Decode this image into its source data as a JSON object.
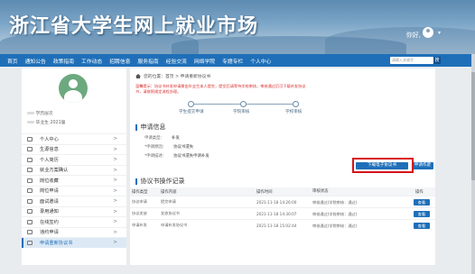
{
  "header": {
    "site_title": "浙江省大学生网上就业市场",
    "user_greeting": "你好, ",
    "user_caret": "▾"
  },
  "nav": {
    "items": [
      "首页",
      "通知公告",
      "政策指南",
      "工作动态",
      "招聘信息",
      "服务指南",
      "经验交流",
      "网络学院",
      "专题专栏",
      "个人中心"
    ],
    "search_placeholder": "请输入关键字",
    "search_button": "搜"
  },
  "sidebar": {
    "info_line_1": "学历层次",
    "info_line_2": "毕业生 2021届",
    "menu": [
      {
        "label": "个人中心",
        "active": false
      },
      {
        "label": "生源信息",
        "active": false
      },
      {
        "label": "个人简历",
        "active": false
      },
      {
        "label": "就业方案确认",
        "active": false
      },
      {
        "label": "岗位收藏",
        "active": false
      },
      {
        "label": "岗位申请",
        "active": false
      },
      {
        "label": "面试邀请",
        "active": false
      },
      {
        "label": "录用通知",
        "active": false
      },
      {
        "label": "在线签约",
        "active": false
      },
      {
        "label": "违约申请",
        "active": false
      },
      {
        "label": "申请重新协议书",
        "active": true
      }
    ]
  },
  "main": {
    "breadcrumb": "您的位置：首页 > 申请重新协议书",
    "notice": "温馨提示：协议书补发申请需由毕业生本人提交，提交后请等待学校审核，审核通过后可下载补发协议书，请按照规定流程办理。",
    "steps": [
      "学生提交申请",
      "学院审核",
      "学校审核"
    ],
    "apply_info_title": "申请信息",
    "apply_fields": [
      {
        "key": "申请类型：",
        "value": "补发"
      },
      {
        "key": "*申请原因：",
        "value": "协议书遗失"
      },
      {
        "key": "*申请描述：",
        "value": "协议书遗失申请补发"
      }
    ],
    "download_button": "下载电子协议书",
    "apply_button": "申请作废",
    "record_title": "协议书操作记录",
    "table": {
      "headers": [
        "操作类型",
        "操作内容",
        "操作时间",
        "审核状态",
        "操作"
      ],
      "rows": [
        {
          "type": "协议申请",
          "content": "提交申请",
          "time": "2021-11-18 14:26:00",
          "status": "审核通过(学院审核：通过)",
          "action": "查看"
        },
        {
          "type": "协议发放",
          "content": "发放协议书",
          "time": "2021-11-18 14:30:07",
          "status": "审核通过(学校审核：通过)",
          "action": "查看"
        },
        {
          "type": "申请补发",
          "content": "申请补发协议书",
          "time": "2021-11-18 15:02:44",
          "status": "审核通过(学院审核：通过)",
          "action": "查看"
        }
      ]
    }
  },
  "colors": {
    "nav_blue": "#1f6fb8",
    "highlight_red": "#d6141b",
    "notice_red": "#d9302f",
    "avatar_green": "#6da97e"
  }
}
